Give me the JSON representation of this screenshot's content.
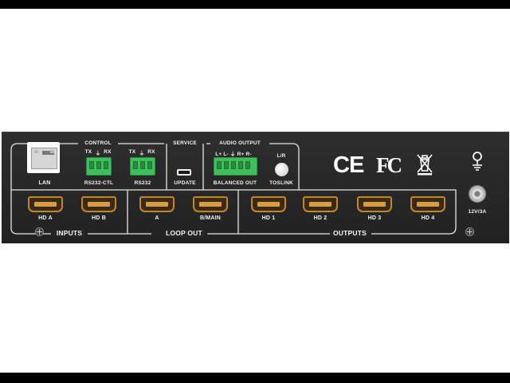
{
  "panel": {
    "ports": {
      "lan": "LAN",
      "rs232_ctl": "RS232-CTL",
      "rs232": "RS232",
      "update": "UPDATE",
      "balanced_out": "BALANCED OUT",
      "toslink": "TOSLINK",
      "toslink_lr": "L/R",
      "power": "12V/3A"
    },
    "sections": {
      "control": "CONTROL",
      "service": "SERVICE",
      "audio_output": "AUDIO OUTPUT",
      "inputs": "INPUTS",
      "loop_out": "LOOP OUT",
      "outputs": "OUTPUTS"
    },
    "pins": {
      "control_tx": "TX",
      "control_gnd": "⏚",
      "control_rx": "RX",
      "rs232_tx": "TX",
      "rs232_gnd": "⏚",
      "rs232_rx": "RX",
      "audio_pins": "L+  L-  ⏚  R+  R-"
    },
    "hdmi": {
      "inputs": [
        "HD A",
        "HD B"
      ],
      "loop_out": [
        "A",
        "B/MAIN"
      ],
      "outputs": [
        "HD 1",
        "HD 2",
        "HD 3",
        "HD 4"
      ]
    },
    "certifications": {
      "ce": "CE",
      "fc": "FC"
    },
    "colors": {
      "chassis": "#272727",
      "terminal_green": "#3fbf5c",
      "hdmi_gold": "#c28633",
      "label": "#f2f2f2"
    }
  }
}
